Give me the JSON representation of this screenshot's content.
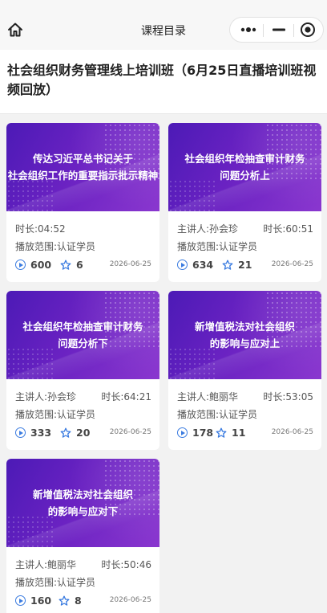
{
  "nav": {
    "title": "课程目录"
  },
  "page": {
    "title": "社会组织财务管理线上培训班（6月25日直播培训班视频回放）"
  },
  "labels": {
    "speaker": "主讲人:",
    "duration": "时长:",
    "scope": "播放范围:"
  },
  "courses": [
    {
      "cover_lines": [
        "传达习近平总书记关于",
        "社会组织工作的重要指示批示精神"
      ],
      "speaker": "",
      "duration": "04:52",
      "scope": "认证学员",
      "plays": "600",
      "favorites": "6",
      "date": "2026-06-25"
    },
    {
      "cover_lines": [
        "社会组织年检抽查审计财务",
        "问题分析上"
      ],
      "speaker": "孙会珍",
      "duration": "60:51",
      "scope": "认证学员",
      "plays": "634",
      "favorites": "21",
      "date": "2026-06-25"
    },
    {
      "cover_lines": [
        "社会组织年检抽查审计财务",
        "问题分析下"
      ],
      "speaker": "孙会珍",
      "duration": "64:21",
      "scope": "认证学员",
      "plays": "333",
      "favorites": "20",
      "date": "2026-06-25"
    },
    {
      "cover_lines": [
        "新增值税法对社会组织",
        "的影响与应对上"
      ],
      "speaker": "鲍丽华",
      "duration": "53:05",
      "scope": "认证学员",
      "plays": "178",
      "favorites": "11",
      "date": "2026-06-25"
    },
    {
      "cover_lines": [
        "新增值税法对社会组织",
        "的影响与应对下"
      ],
      "speaker": "鲍丽华",
      "duration": "50:46",
      "scope": "认证学员",
      "plays": "160",
      "favorites": "8",
      "date": "2026-06-25"
    }
  ],
  "icons": {
    "home": "home-icon",
    "more": "more-dots-icon",
    "minimize": "minimize-icon",
    "close": "close-circle-icon",
    "play": "play-icon",
    "star": "star-icon"
  },
  "colors": {
    "cover_start": "#4c1ab6",
    "cover_end": "#8a37cf",
    "icon_blue": "#3a7be0"
  }
}
